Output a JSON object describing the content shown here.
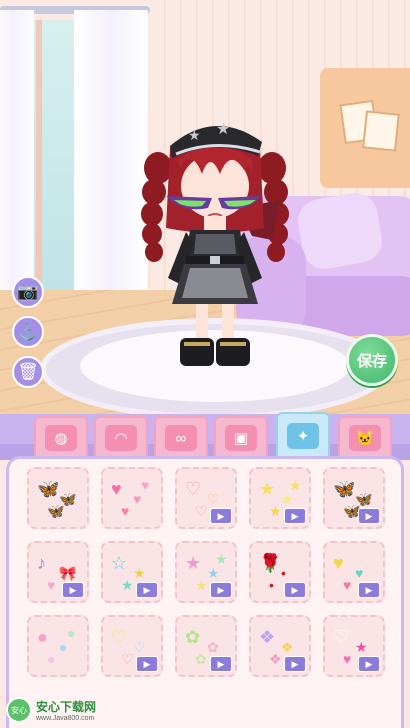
{
  "scene": {
    "room": "bedroom"
  },
  "tools": [
    {
      "icon": "camera-icon",
      "glyph": "📷"
    },
    {
      "icon": "hanger-icon",
      "glyph": "⚓"
    },
    {
      "icon": "trash-icon",
      "glyph": "🗑"
    }
  ],
  "save_label": "保存",
  "tabs": [
    {
      "icon": "makeup-icon",
      "glyph": "◍",
      "active": false
    },
    {
      "icon": "headband-icon",
      "glyph": "◠",
      "active": false
    },
    {
      "icon": "glasses-icon",
      "glyph": "∞",
      "active": false
    },
    {
      "icon": "background-icon",
      "glyph": "▣",
      "active": false
    },
    {
      "icon": "magic-wand-icon",
      "glyph": "✦",
      "active": true
    },
    {
      "icon": "pet-icon",
      "glyph": "🐱",
      "active": false
    }
  ],
  "items": [
    {
      "name": "butterflies-blue",
      "glyphs": [
        "🦋",
        "🦋",
        "🦋"
      ],
      "colors": [
        "#8fb3f2",
        "#9ec2f5",
        "#b2c9f7"
      ],
      "locked": false
    },
    {
      "name": "hearts-pink",
      "glyphs": [
        "♥",
        "♥",
        "♥",
        "♥"
      ],
      "colors": [
        "#f56fa0",
        "#f39ac0",
        "#ff7eb0",
        "#f7a6c8"
      ],
      "locked": false
    },
    {
      "name": "hearts-outline",
      "glyphs": [
        "♡",
        "♡",
        "♡"
      ],
      "colors": [
        "#f2a0b8",
        "#f5c07a",
        "#f3a4c6"
      ],
      "locked": true
    },
    {
      "name": "stars-yellow",
      "glyphs": [
        "★",
        "★",
        "★",
        "★"
      ],
      "colors": [
        "#f5e35a",
        "#f8ea7d",
        "#f2d94b",
        "#f5e35a"
      ],
      "locked": true
    },
    {
      "name": "butterflies-mix",
      "glyphs": [
        "🦋",
        "🦋",
        "🦋"
      ],
      "colors": [
        "#b5a4f2",
        "#9fc4f5",
        "#f0a6d4"
      ],
      "locked": true
    },
    {
      "name": "music-bow",
      "glyphs": [
        "♪",
        "🎀",
        "♥"
      ],
      "colors": [
        "#b07fe0",
        "#f58cb0",
        "#f5a9c7"
      ],
      "locked": true
    },
    {
      "name": "stars-neon",
      "glyphs": [
        "☆",
        "★",
        "★"
      ],
      "colors": [
        "#5bd6e8",
        "#f2d245",
        "#6fe0c6"
      ],
      "locked": true
    },
    {
      "name": "stars-pastel",
      "glyphs": [
        "★",
        "★",
        "★",
        "★"
      ],
      "colors": [
        "#f49ad2",
        "#8fd5f0",
        "#f7e27a",
        "#a7e8b2"
      ],
      "locked": true
    },
    {
      "name": "rose-red",
      "glyphs": [
        "🌹",
        "•",
        "•"
      ],
      "colors": [
        "#c02028",
        "#c02028",
        "#c02028"
      ],
      "locked": true
    },
    {
      "name": "hearts-glow",
      "glyphs": [
        "♥",
        "♥",
        "♥"
      ],
      "colors": [
        "#f5d64a",
        "#62d5c2",
        "#f07aa6"
      ],
      "locked": true
    },
    {
      "name": "bubbles",
      "glyphs": [
        "●",
        "●",
        "●",
        "●"
      ],
      "colors": [
        "#f5a0c8",
        "#a5d9f2",
        "#f7c3e0",
        "#b8e6c6"
      ],
      "locked": false
    },
    {
      "name": "hearts-neon",
      "glyphs": [
        "♡",
        "♡",
        "♡"
      ],
      "colors": [
        "#f5e35a",
        "#a0d8ef",
        "#f39ac0"
      ],
      "locked": true
    },
    {
      "name": "flowers-green",
      "glyphs": [
        "✿",
        "✿",
        "✿"
      ],
      "colors": [
        "#b5e38d",
        "#f5b5c9",
        "#c8e9a6"
      ],
      "locked": true
    },
    {
      "name": "candy-wrappers",
      "glyphs": [
        "❖",
        "❖",
        "❖"
      ],
      "colors": [
        "#b8a6f0",
        "#f5d35a",
        "#f29ac0"
      ],
      "locked": true
    },
    {
      "name": "hearts-magenta",
      "glyphs": [
        "♡",
        "★",
        "♥"
      ],
      "colors": [
        "#ffffff",
        "#f04fa0",
        "#f571b8"
      ],
      "locked": true
    }
  ],
  "watermark": {
    "logo": "安心",
    "title": "安心下载网",
    "url": "www.Java800.com"
  }
}
